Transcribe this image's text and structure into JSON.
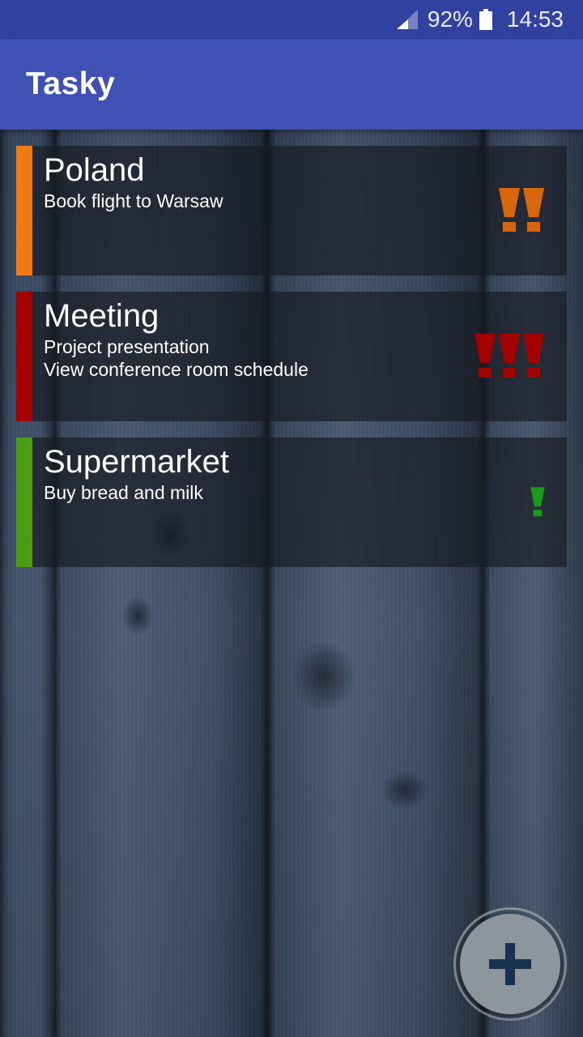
{
  "status_bar": {
    "battery_percent": "92%",
    "time": "14:53",
    "icons": [
      "signal-icon",
      "battery-icon"
    ]
  },
  "app_bar": {
    "title": "Tasky"
  },
  "tasks": [
    {
      "title": "Poland",
      "description": "Book flight to Warsaw",
      "color": "#f07b12",
      "priority": 2,
      "priority_color": "#d9660d"
    },
    {
      "title": "Meeting",
      "description": "Project presentation\nView conference room schedule",
      "color": "#a30000",
      "priority": 3,
      "priority_color": "#a30000"
    },
    {
      "title": "Supermarket",
      "description": "Buy bread and milk",
      "color": "#4a9c10",
      "priority": 1,
      "priority_color": "#1a9b1a"
    }
  ],
  "fab": {
    "icon": "plus-icon",
    "icon_color": "#17324f"
  }
}
